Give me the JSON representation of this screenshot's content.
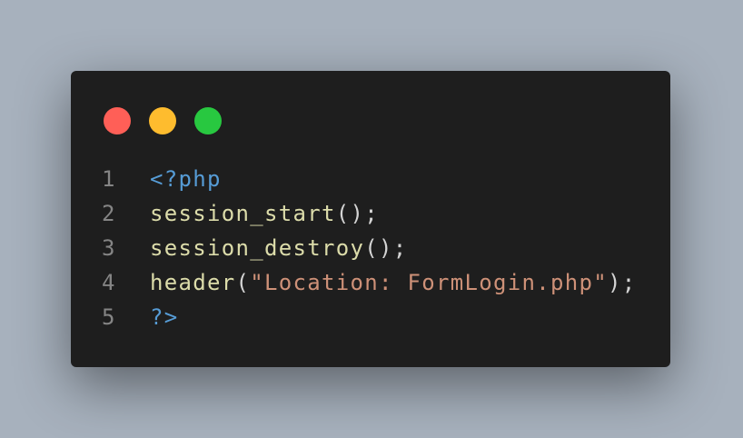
{
  "colors": {
    "red": "#ff5f57",
    "yellow": "#febc2e",
    "green": "#28c840",
    "tag": "#569cd6",
    "func": "#dcdcaa",
    "punct": "#d4d4d4",
    "string": "#ce9178"
  },
  "lines": [
    {
      "number": "1",
      "tokens": [
        {
          "text": "<?php",
          "kind": "tag"
        }
      ]
    },
    {
      "number": "2",
      "tokens": [
        {
          "text": "session_start",
          "kind": "func"
        },
        {
          "text": "();",
          "kind": "punct"
        }
      ]
    },
    {
      "number": "3",
      "tokens": [
        {
          "text": "session_destroy",
          "kind": "func"
        },
        {
          "text": "();",
          "kind": "punct"
        }
      ]
    },
    {
      "number": "4",
      "tokens": [
        {
          "text": "header",
          "kind": "func"
        },
        {
          "text": "(",
          "kind": "punct"
        },
        {
          "text": "\"Location: FormLogin.php\"",
          "kind": "string"
        },
        {
          "text": ");",
          "kind": "punct"
        }
      ]
    },
    {
      "number": "5",
      "tokens": [
        {
          "text": "?>",
          "kind": "tag"
        }
      ]
    }
  ]
}
